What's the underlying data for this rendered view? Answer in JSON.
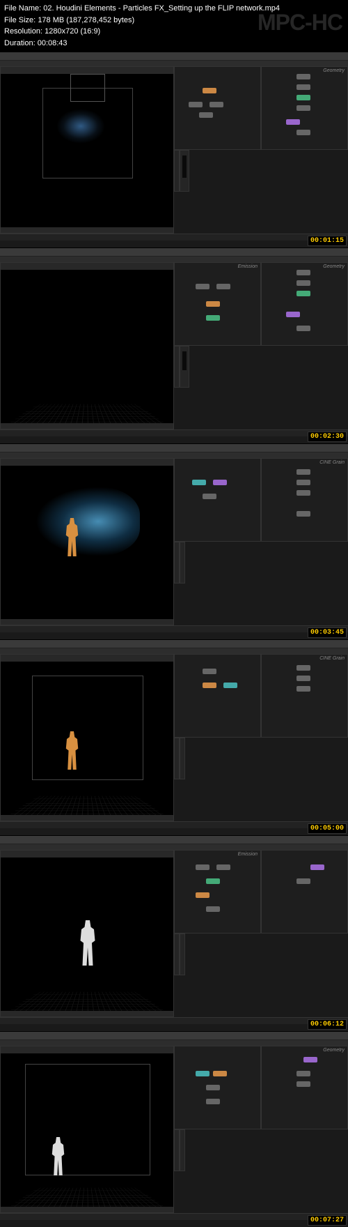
{
  "watermark": "MPC-HC",
  "header": {
    "file_name_label": "File Name:",
    "file_name": "02. Houdini Elements - Particles FX_Setting up the FLIP network.mp4",
    "file_size_label": "File Size:",
    "file_size": "178 MB (187,278,452 bytes)",
    "resolution_label": "Resolution:",
    "resolution": "1280x720 (16:9)",
    "duration_label": "Duration:",
    "duration": "00:08:43"
  },
  "panel_labels": {
    "geometry": "Geometry",
    "emission": "Emission",
    "cinegrain": "CINE Grain"
  },
  "thumbnails": [
    {
      "timestamp": "00:01:15",
      "scene": "wirebox_particles"
    },
    {
      "timestamp": "00:02:30",
      "scene": "grid_empty"
    },
    {
      "timestamp": "00:03:45",
      "scene": "particles_figure"
    },
    {
      "timestamp": "00:05:00",
      "scene": "box_figure_orange"
    },
    {
      "timestamp": "00:06:12",
      "scene": "figure_white_grid"
    },
    {
      "timestamp": "00:07:27",
      "scene": "box_figure_white"
    }
  ]
}
